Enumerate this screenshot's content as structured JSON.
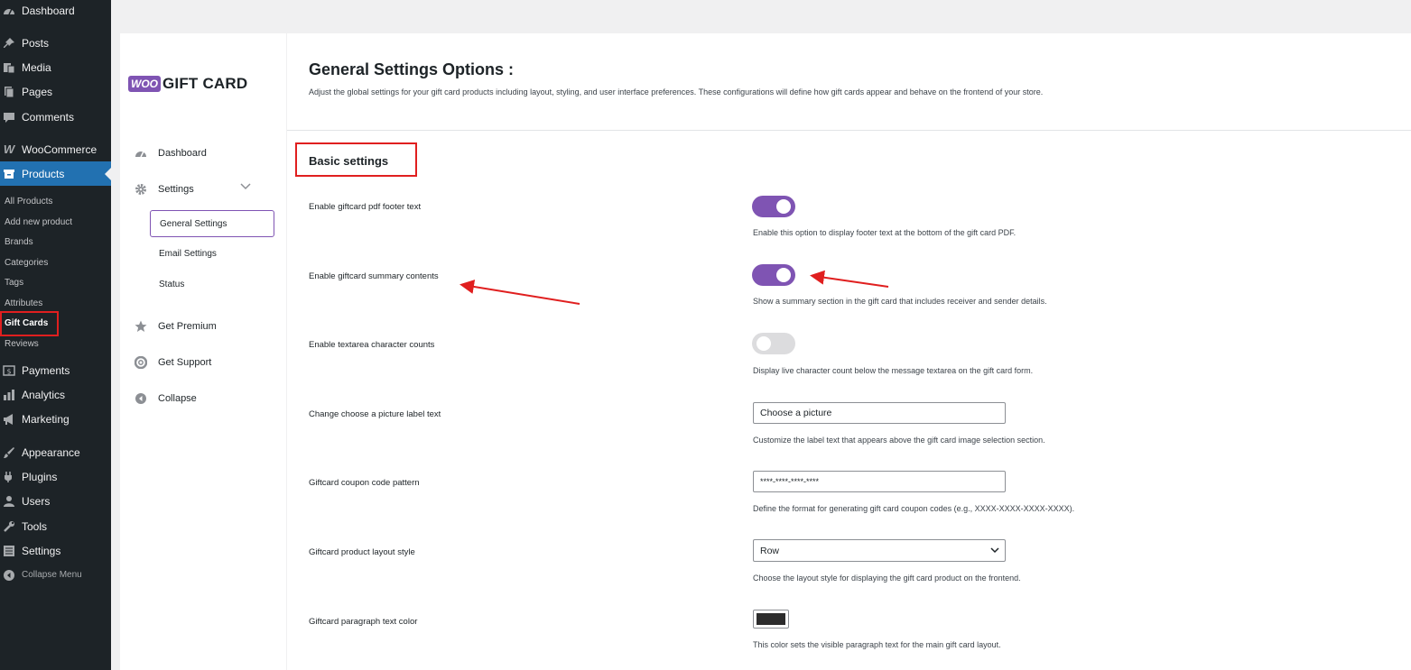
{
  "wp_menu": {
    "items": [
      {
        "label": "Dashboard",
        "icon": "dashboard-icon"
      },
      {
        "label": "Posts",
        "icon": "pin-icon"
      },
      {
        "label": "Media",
        "icon": "media-icon"
      },
      {
        "label": "Pages",
        "icon": "pages-icon"
      },
      {
        "label": "Comments",
        "icon": "comment-icon"
      },
      {
        "label": "WooCommerce",
        "icon": "woo-icon"
      },
      {
        "label": "Products",
        "icon": "products-icon"
      },
      {
        "label": "Payments",
        "icon": "payments-icon"
      },
      {
        "label": "Analytics",
        "icon": "analytics-icon"
      },
      {
        "label": "Marketing",
        "icon": "marketing-icon"
      },
      {
        "label": "Appearance",
        "icon": "appearance-icon"
      },
      {
        "label": "Plugins",
        "icon": "plugins-icon"
      },
      {
        "label": "Users",
        "icon": "users-icon"
      },
      {
        "label": "Tools",
        "icon": "tools-icon"
      },
      {
        "label": "Settings",
        "icon": "settings-icon"
      },
      {
        "label": "Collapse Menu",
        "icon": "collapse-icon"
      }
    ],
    "products_submenu": [
      "All Products",
      "Add new product",
      "Brands",
      "Categories",
      "Tags",
      "Attributes",
      "Gift Cards",
      "Reviews"
    ]
  },
  "plugin": {
    "logo_badge": "WOO",
    "logo_text": "GIFT CARD",
    "nav": {
      "dashboard": "Dashboard",
      "settings": "Settings",
      "general_settings": "General Settings",
      "email_settings": "Email Settings",
      "status": "Status",
      "get_premium": "Get Premium",
      "get_support": "Get Support",
      "collapse": "Collapse"
    }
  },
  "page": {
    "title": "General Settings Options :",
    "description": "Adjust the global settings for your gift card products including layout, styling, and user interface preferences. These configurations will define how gift cards appear and behave on the frontend of your store.",
    "section_title": "Basic settings"
  },
  "settings": {
    "pdf_footer": {
      "label": "Enable giftcard pdf footer text",
      "help": "Enable this option to display footer text at the bottom of the gift card PDF.",
      "enabled": true
    },
    "summary": {
      "label": "Enable giftcard summary contents",
      "help": "Show a summary section in the gift card that includes receiver and sender details.",
      "enabled": true
    },
    "char_counts": {
      "label": "Enable textarea character counts",
      "help": "Display live character count below the message textarea on the gift card form.",
      "enabled": false
    },
    "picture_label": {
      "label": "Change choose a picture label text",
      "value": "Choose a picture",
      "help": "Customize the label text that appears above the gift card image selection section."
    },
    "coupon_pattern": {
      "label": "Giftcard coupon code pattern",
      "value": "****-****-****-****",
      "help": "Define the format for generating gift card coupon codes (e.g., XXXX-XXXX-XXXX-XXXX)."
    },
    "layout_style": {
      "label": "Giftcard product layout style",
      "value": "Row",
      "help": "Choose the layout style for displaying the gift card product on the frontend."
    },
    "paragraph_color": {
      "label": "Giftcard paragraph text color",
      "value": "#2c2c2c",
      "help": "This color sets the visible paragraph text for the main gift card layout."
    }
  },
  "colors": {
    "accent": "#7f54b3",
    "wp_active": "#2271b1",
    "highlight": "#e01f1f"
  }
}
